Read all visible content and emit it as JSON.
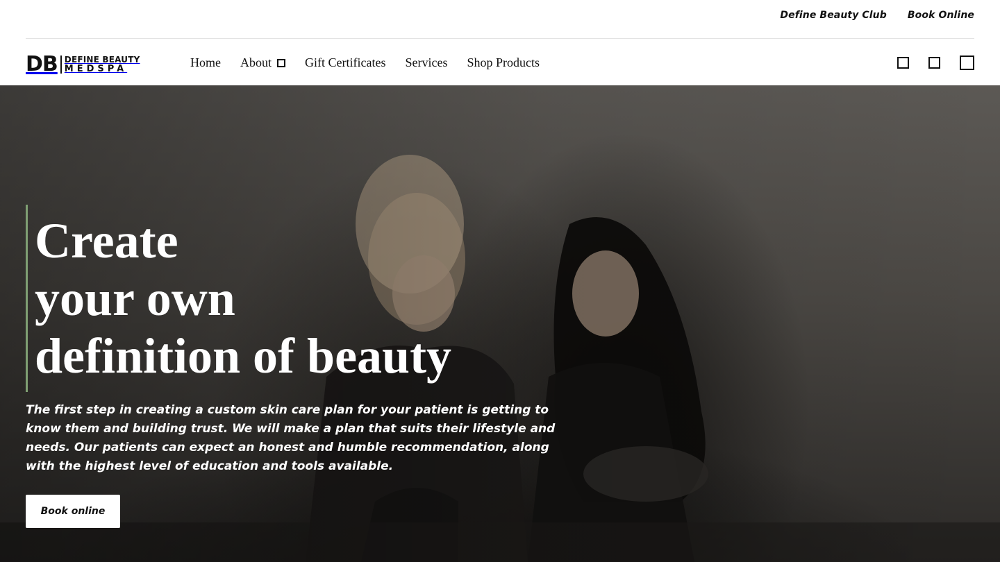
{
  "utility": {
    "links": [
      "Define Beauty Club",
      "Book Online"
    ]
  },
  "logo": {
    "mark": "DB",
    "line1": "DEFINE BEAUTY",
    "line2": "MEDSPA"
  },
  "nav": {
    "items": [
      "Home",
      "About",
      "Gift Certificates",
      "Services",
      "Shop Products"
    ],
    "icons": [
      "search-icon",
      "account-icon",
      "cart-icon"
    ]
  },
  "hero": {
    "headline_line1": "Create",
    "headline_line2": "your own",
    "headline_line3": "definition of beauty",
    "intro": "The first step in creating a custom skin care plan for your patient is getting to know them and building trust. We will make a plan that suits their lifestyle and needs. Our patients can expect an honest and humble recommendation, along with the highest level of education and tools available.",
    "button_label": "Book online",
    "accent_color": "#7f9f73"
  }
}
